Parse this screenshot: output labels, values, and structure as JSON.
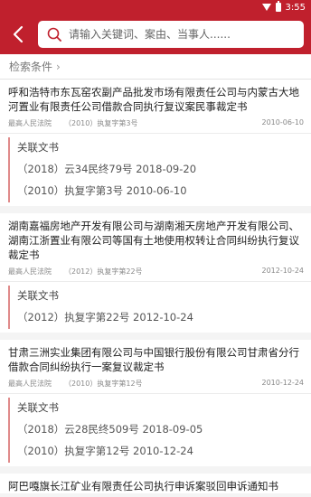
{
  "statusbar": {
    "time": "3:55"
  },
  "header": {
    "search_placeholder": "请输入关键词、案由、当事人......"
  },
  "filter": {
    "label": "检索条件",
    "chevron": "›"
  },
  "cases": [
    {
      "title": "呼和浩特市东瓦窑农副产品批发市场有限责任公司与内蒙古大地河置业有限责任公司借款合同执行复议案民事裁定书",
      "court": "最高人民法院",
      "case_no": "（2010）执复字第3号",
      "date": "2010-06-10",
      "related_label": "关联文书",
      "related": [
        "（2018）云34民终79号 2018-09-20",
        "（2010）执复字第3号 2010-06-10"
      ]
    },
    {
      "title": "湖南嘉福房地产开发有限公司与湖南湘天房地产开发有限公司、湖南江浙置业有限公司等国有土地使用权转让合同纠纷执行复议裁定书",
      "court": "最高人民法院",
      "case_no": "（2012）执复字第22号",
      "date": "2012-10-24",
      "related_label": "关联文书",
      "related": [
        "（2012）执复字第22号 2012-10-24"
      ]
    },
    {
      "title": "甘肃三洲实业集团有限公司与中国银行股份有限公司甘肃省分行借款合同纠纷执行一案复议裁定书",
      "court": "最高人民法院",
      "case_no": "（2010）执复字第12号",
      "date": "2010-12-24",
      "related_label": "关联文书",
      "related": [
        "（2018）云28民终509号 2018-09-05",
        "（2010）执复字第12号 2010-12-24"
      ]
    },
    {
      "title": "阿巴嘎旗长江矿业有限责任公司执行申诉案驳回申诉通知书"
    }
  ]
}
